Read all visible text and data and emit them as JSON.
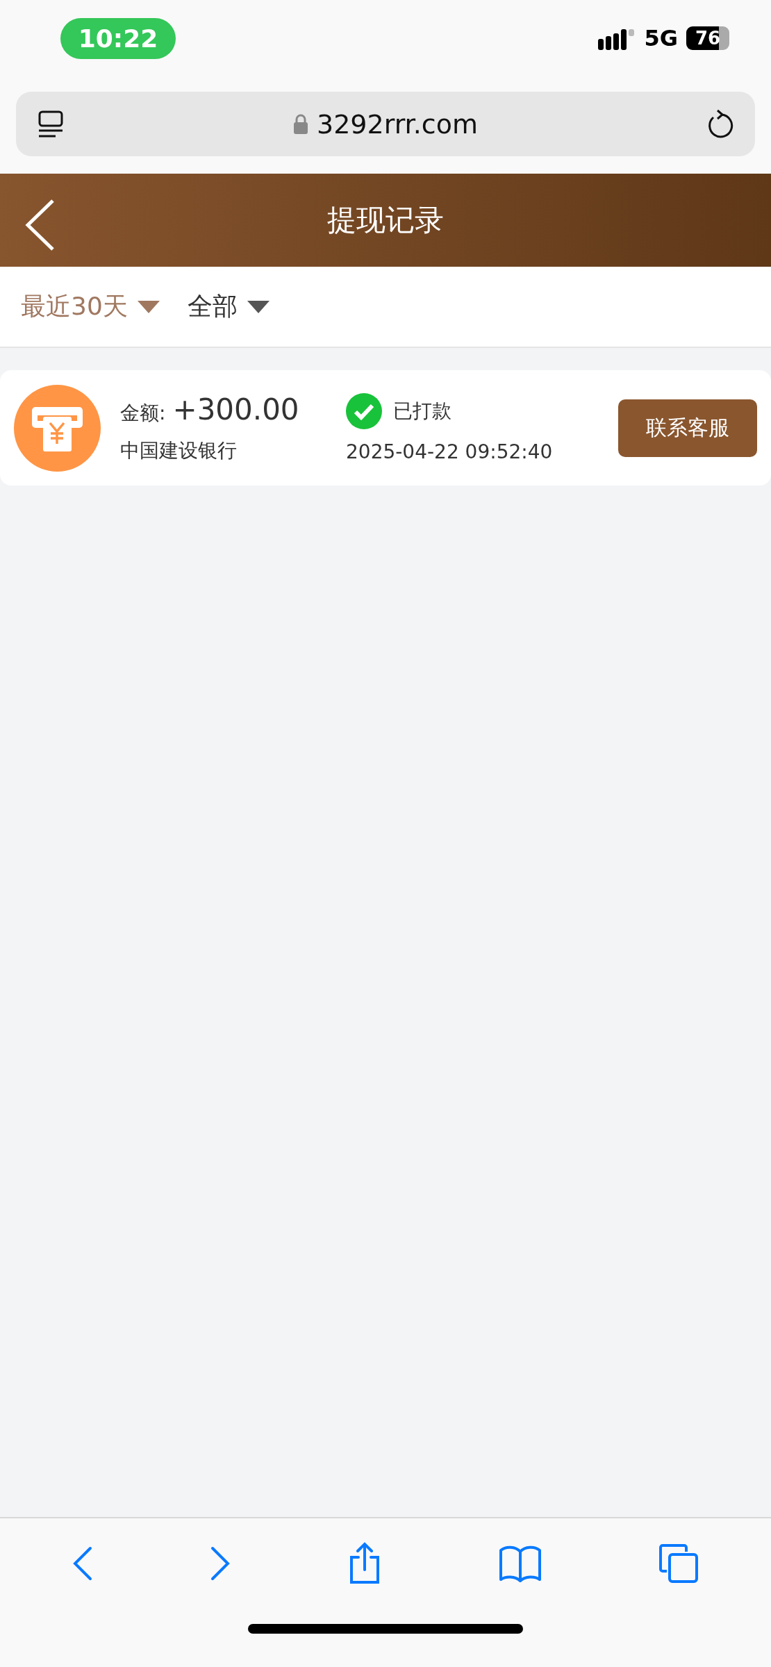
{
  "status_bar": {
    "time": "10:22",
    "network": "5G",
    "battery": "76"
  },
  "browser": {
    "url": "3292rrr.com"
  },
  "header": {
    "title": "提现记录"
  },
  "filters": [
    {
      "label": "最近30天",
      "selected": true
    },
    {
      "label": "全部",
      "selected": false
    }
  ],
  "records": [
    {
      "amount_label": "金额:",
      "amount": "+300.00",
      "bank": "中国建设银行",
      "status": "已打款",
      "time": "2025-04-22 09:52:40",
      "action": "联系客服"
    }
  ]
}
